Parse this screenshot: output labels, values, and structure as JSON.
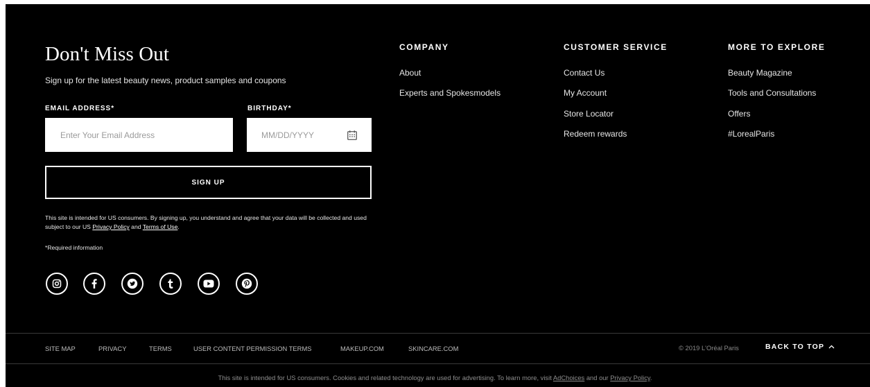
{
  "signup": {
    "title": "Don't Miss Out",
    "subtitle": "Sign up for the latest beauty news, product samples and coupons",
    "email_label": "EMAIL ADDRESS*",
    "email_placeholder": "Enter Your Email Address",
    "email_value": "",
    "birthday_label": "BIRTHDAY*",
    "birthday_placeholder": "MM/DD/YYYY",
    "birthday_value": "",
    "button_label": "SIGN UP",
    "legal_prefix": "This site is intended for US consumers. By signing up, you understand and agree that your data will be collected and used subject to our US ",
    "privacy_link": "Privacy Policy",
    "legal_and": " and ",
    "terms_link": "Terms of Use",
    "legal_suffix": ".",
    "required_note": "*Required information"
  },
  "social": [
    "instagram-icon",
    "facebook-icon",
    "twitter-icon",
    "tumblr-icon",
    "youtube-icon",
    "pinterest-icon"
  ],
  "columns": {
    "company": {
      "heading": "COMPANY",
      "links": [
        "About",
        "Experts and Spokesmodels"
      ]
    },
    "customer_service": {
      "heading": "CUSTOMER SERVICE",
      "links": [
        "Contact Us",
        "My Account",
        "Store Locator",
        "Redeem rewards"
      ]
    },
    "explore": {
      "heading": "MORE TO EXPLORE",
      "links": [
        "Beauty Magazine",
        "Tools and Consultations",
        "Offers",
        "#LorealParis"
      ]
    }
  },
  "bottom": {
    "links": [
      "SITE MAP",
      "PRIVACY",
      "TERMS",
      "USER CONTENT PERMISSION TERMS",
      "MAKEUP.COM",
      "SKINCARE.COM"
    ],
    "copyright": "© 2019 L'Oréal Paris",
    "back_to_top": "BACK TO TOP"
  },
  "footnote": {
    "text": "This site is intended for US consumers. Cookies and related technology are used for advertising. To learn more, visit ",
    "adchoices_link": "AdChoices",
    "middle": " and our ",
    "privacy_link": "Privacy Policy",
    "end": "."
  },
  "colors": {
    "background": "#000000",
    "text": "#ffffff",
    "muted": "#8e8e8e",
    "divider": "#3a3a3a"
  }
}
